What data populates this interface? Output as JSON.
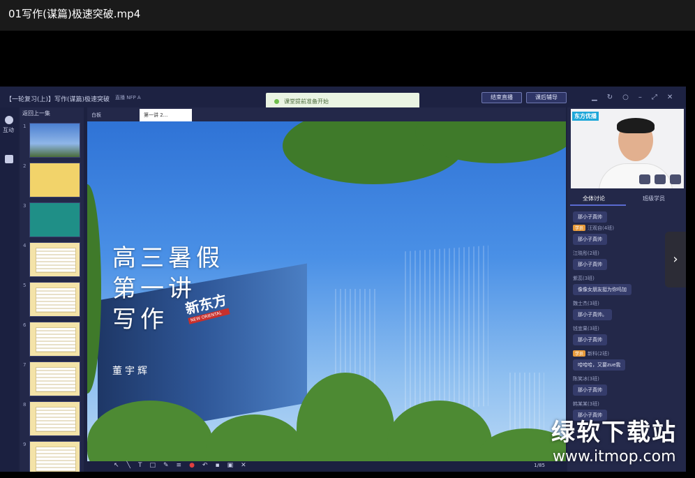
{
  "window": {
    "title": "01写作(谋篇)极速突破.mp4"
  },
  "classroom": {
    "breadcrumb": "【一轮复习(上)】写作(谋篇)极速突破",
    "tag": "直播 NFP A",
    "toast": "课堂提前准备开始",
    "end_live_label": "结束直播",
    "after_class_label": "课后辅导"
  },
  "left_nav": {
    "interact_label": "互动"
  },
  "thumbnails": {
    "back_label": "返回上一集",
    "pages": [
      "1",
      "2",
      "3",
      "4",
      "5",
      "6",
      "7",
      "8",
      "9"
    ]
  },
  "tabs": [
    {
      "label": "白板"
    },
    {
      "label": "第一讲 2..."
    }
  ],
  "slide": {
    "title_lines": [
      "高三暑假",
      "第一讲",
      "写作"
    ],
    "author": "董宇辉",
    "logo_text": "新东方",
    "logo_sub": "NEW ORIENTAL"
  },
  "toolbar": {
    "page_indicator": "1/85"
  },
  "camera": {
    "brand": "东方优播"
  },
  "chat": {
    "tab_all": "全体讨论",
    "tab_assistant": "班级学员",
    "messages": [
      {
        "name": "",
        "badge": "",
        "text": "那小子真帅"
      },
      {
        "name": "汪观自(4班)",
        "badge": "学员",
        "text": "那小子真帅"
      },
      {
        "name": "江晓彤(2班)",
        "badge": "",
        "text": "那小子真帅"
      },
      {
        "name": "紫蕊(3班)",
        "badge": "",
        "text": "像像女朋友挺为你吗加"
      },
      {
        "name": "魏士杰(3班)",
        "badge": "",
        "text": "那小子真帅。"
      },
      {
        "name": "钱宜果(3班)",
        "badge": "",
        "text": "那小子真帅"
      },
      {
        "name": "新科(2班)",
        "badge": "学员",
        "text": "哈哈哈，又要zue我"
      },
      {
        "name": "陈笑冰(3班)",
        "badge": "",
        "text": "那小子真帅"
      },
      {
        "name": "韩某某(3班)",
        "badge": "",
        "text": "那小子真帅"
      }
    ]
  },
  "watermark": {
    "text": "绿软下载站",
    "url": "www.itmop.com"
  }
}
